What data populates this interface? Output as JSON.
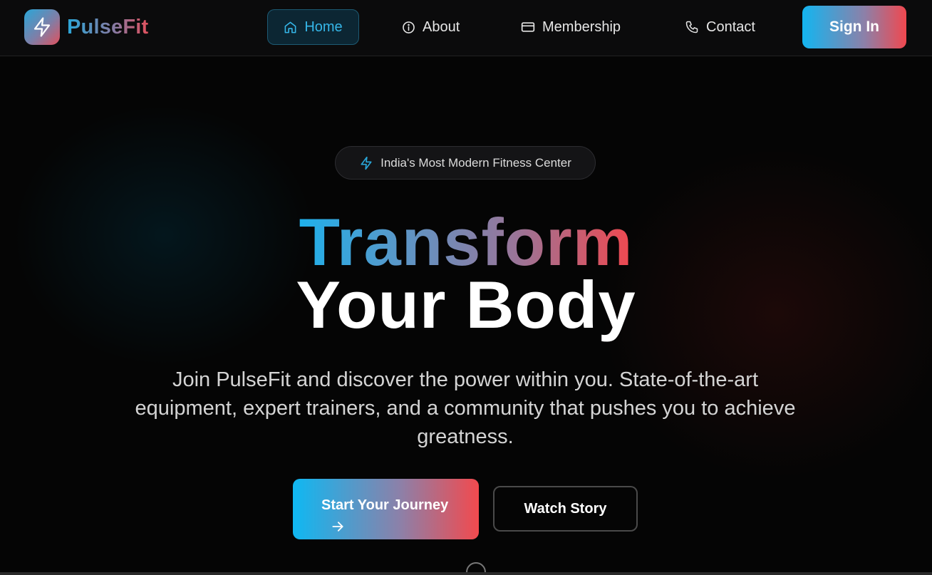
{
  "brand": {
    "name": "PulseFit",
    "icon": "lightning-bolt-icon"
  },
  "nav": {
    "items": [
      {
        "label": "Home",
        "icon": "home-icon",
        "active": true
      },
      {
        "label": "About",
        "icon": "info-icon",
        "active": false
      },
      {
        "label": "Membership",
        "icon": "credit-card-icon",
        "active": false
      },
      {
        "label": "Contact",
        "icon": "phone-icon",
        "active": false
      }
    ],
    "signin_label": "Sign In"
  },
  "hero": {
    "badge": {
      "icon": "lightning-bolt-icon",
      "text": "India's Most Modern Fitness Center"
    },
    "title_line1": "Transform",
    "title_line2": "Your Body",
    "description": "Join PulseFit and discover the power within you. State-of-the-art equipment, expert trainers, and a community that pushes you to achieve greatness.",
    "primary_cta": {
      "label": "Start Your Journey",
      "icon": "arrow-right-icon"
    },
    "secondary_cta": {
      "label": "Watch Story"
    }
  },
  "colors": {
    "accent_cyan": "#13b5f0",
    "accent_red": "#f0484f",
    "background": "#050505"
  }
}
